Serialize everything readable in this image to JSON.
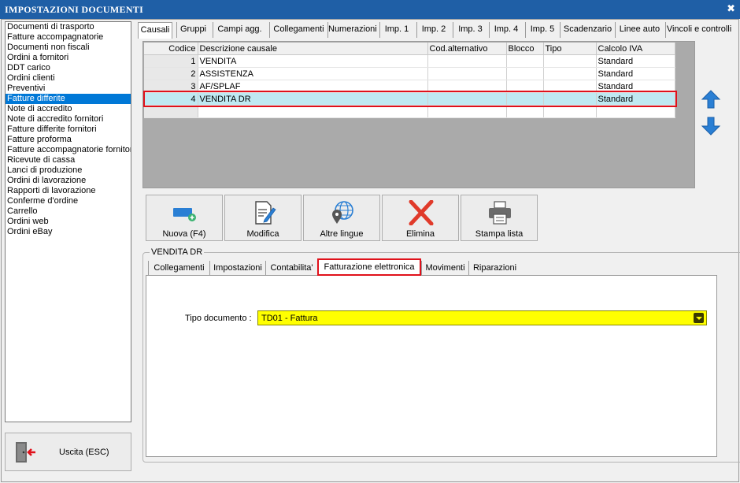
{
  "window": {
    "title": "IMPOSTAZIONI DOCUMENTI",
    "close_glyph": "✖"
  },
  "doc_types": [
    {
      "label": "Documenti di trasporto",
      "selected": false
    },
    {
      "label": "Fatture accompagnatorie",
      "selected": false
    },
    {
      "label": "Documenti non fiscali",
      "selected": false
    },
    {
      "label": "Ordini a fornitori",
      "selected": false
    },
    {
      "label": "DDT carico",
      "selected": false
    },
    {
      "label": "Ordini clienti",
      "selected": false
    },
    {
      "label": "Preventivi",
      "selected": false
    },
    {
      "label": "Fatture differite",
      "selected": true
    },
    {
      "label": "Note di accredito",
      "selected": false
    },
    {
      "label": "Note di accredito fornitori",
      "selected": false
    },
    {
      "label": "Fatture differite fornitori",
      "selected": false
    },
    {
      "label": "Fatture proforma",
      "selected": false
    },
    {
      "label": "Fatture accompagnatorie fornitori",
      "selected": false
    },
    {
      "label": "Ricevute di cassa",
      "selected": false
    },
    {
      "label": "Lanci di produzione",
      "selected": false
    },
    {
      "label": "Ordini di lavorazione",
      "selected": false
    },
    {
      "label": "Rapporti di lavorazione",
      "selected": false
    },
    {
      "label": "Conferme d'ordine",
      "selected": false
    },
    {
      "label": "Carrello",
      "selected": false
    },
    {
      "label": "Ordini web",
      "selected": false
    },
    {
      "label": "Ordini eBay",
      "selected": false
    }
  ],
  "exit_button": {
    "label": "Uscita (ESC)",
    "icon": "exit-door-icon"
  },
  "main_tabs": [
    {
      "label": "Causali",
      "active": true
    },
    {
      "label": "Gruppi",
      "active": false
    },
    {
      "label": "Campi agg.",
      "active": false
    },
    {
      "label": "Collegamenti",
      "active": false
    },
    {
      "label": "Numerazioni",
      "active": false
    },
    {
      "label": "Imp. 1",
      "active": false
    },
    {
      "label": "Imp. 2",
      "active": false
    },
    {
      "label": "Imp. 3",
      "active": false
    },
    {
      "label": "Imp. 4",
      "active": false
    },
    {
      "label": "Imp. 5",
      "active": false
    },
    {
      "label": "Scadenzario",
      "active": false
    },
    {
      "label": "Linee auto",
      "active": false
    },
    {
      "label": "Vincoli e controlli",
      "active": false
    }
  ],
  "grid": {
    "columns": [
      "Codice",
      "Descrizione causale",
      "Cod.alternativo",
      "Blocco",
      "Tipo",
      "Calcolo IVA"
    ],
    "rows": [
      {
        "codice": "1",
        "descrizione": "VENDITA",
        "cod_alt": "",
        "blocco": "",
        "tipo": "",
        "calcolo_iva": "Standard",
        "selected": false
      },
      {
        "codice": "2",
        "descrizione": "ASSISTENZA",
        "cod_alt": "",
        "blocco": "",
        "tipo": "",
        "calcolo_iva": "Standard",
        "selected": false
      },
      {
        "codice": "3",
        "descrizione": "AF/SPLAF",
        "cod_alt": "",
        "blocco": "",
        "tipo": "",
        "calcolo_iva": "Standard",
        "selected": false
      },
      {
        "codice": "4",
        "descrizione": "VENDITA DR",
        "cod_alt": "",
        "blocco": "",
        "tipo": "",
        "calcolo_iva": "Standard",
        "selected": true
      }
    ]
  },
  "side_arrows": {
    "up_icon": "arrow-up-icon",
    "down_icon": "arrow-down-icon",
    "color": "#2a7fd4"
  },
  "actions": [
    {
      "label": "Nuova (F4)",
      "icon": "new-card-icon"
    },
    {
      "label": "Modifica",
      "icon": "edit-document-icon"
    },
    {
      "label": "Altre lingue",
      "icon": "globe-pin-icon"
    },
    {
      "label": "Elimina",
      "icon": "delete-x-icon"
    },
    {
      "label": "Stampa lista",
      "icon": "printer-icon"
    }
  ],
  "detail": {
    "group_caption": "VENDITA DR",
    "tabs": [
      {
        "label": "Collegamenti",
        "active": false
      },
      {
        "label": "Impostazioni",
        "active": false
      },
      {
        "label": "Contabilita'",
        "active": false
      },
      {
        "label": "Fatturazione elettronica",
        "active": true
      },
      {
        "label": "Movimenti",
        "active": false
      },
      {
        "label": "Riparazioni",
        "active": false
      }
    ],
    "tipo_documento_label": "Tipo documento :",
    "tipo_documento_value": "TD01 - Fattura"
  },
  "colors": {
    "titlebar": "#1f5fa6",
    "selection": "#0078d7",
    "row_highlight": "#bfe9f2",
    "callout": "#e0111b",
    "field_yellow": "#ffff00",
    "delete_red": "#e03a2a"
  }
}
